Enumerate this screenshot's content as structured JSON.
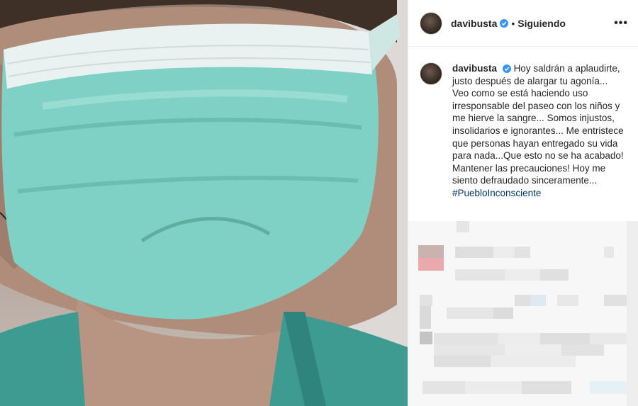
{
  "post": {
    "username": "davibusta",
    "separator": "•",
    "follow_status": "Siguiendo",
    "more_label": "•••",
    "caption": "Hoy saldrán a aplaudirte, justo después de alargar tu agonía... Veo como se está haciendo uso irresponsable del paseo con los niños y me hierve la sangre... Somos injustos, insolidarios e ignorantes... Me entristece que personas hayan entregado su vida para nada...Que esto no se ha acabado! Mantener las precauciones! Hoy me siento defraudado sinceramente...",
    "hashtag": "#PuebloInconsciente"
  },
  "icons": {
    "verified": "verified-badge-icon",
    "more": "more-options-icon"
  },
  "colors": {
    "verified_blue": "#3897f0",
    "hashtag": "#00376b",
    "mask": "#7fd1c5",
    "scrubs": "#3d9b92"
  }
}
